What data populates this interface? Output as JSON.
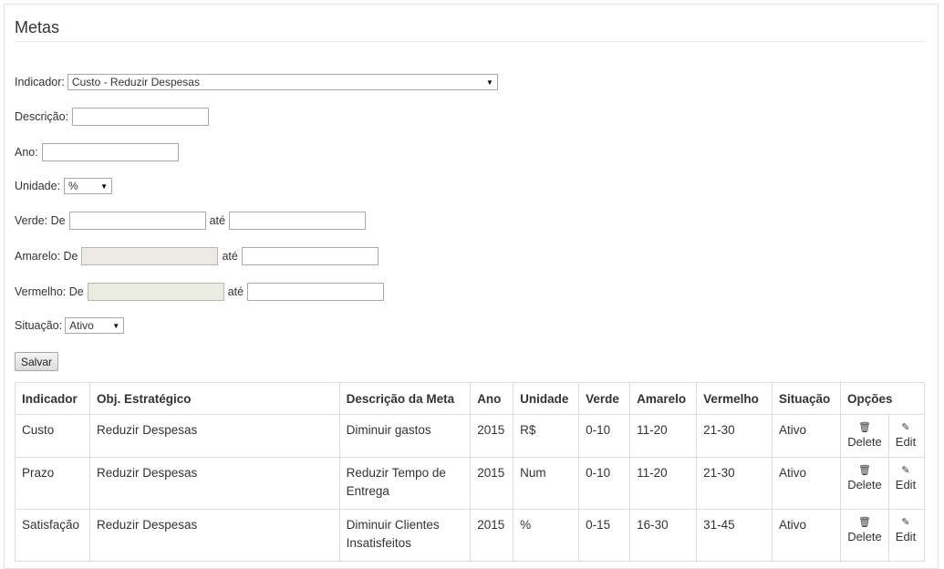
{
  "page": {
    "title": "Metas"
  },
  "form": {
    "indicador": {
      "label": "Indicador:",
      "value": "Custo - Reduzir Despesas"
    },
    "descricao": {
      "label": "Descrição:",
      "value": ""
    },
    "ano": {
      "label": "Ano:",
      "value": ""
    },
    "unidade": {
      "label": "Unidade:",
      "value": "%"
    },
    "verde": {
      "label": "Verde: De",
      "ate": "até",
      "from": "",
      "to": ""
    },
    "amarelo": {
      "label": "Amarelo: De",
      "ate": "até",
      "from": "",
      "to": ""
    },
    "vermelho": {
      "label": "Vermelho: De",
      "ate": "até",
      "from": "",
      "to": ""
    },
    "situacao": {
      "label": "Situação:",
      "value": "Ativo"
    },
    "save_label": "Salvar"
  },
  "table": {
    "headers": [
      "Indicador",
      "Obj. Estratégico",
      "Descrição da Meta",
      "Ano",
      "Unidade",
      "Verde",
      "Amarelo",
      "Vermelho",
      "Situação",
      "Opções"
    ],
    "delete_label": "Delete",
    "edit_label": "Edit",
    "rows": [
      {
        "indicador": "Custo",
        "objetivo": "Reduzir Despesas",
        "descricao": "Diminuir gastos",
        "ano": "2015",
        "unidade": "R$",
        "verde": "0-10",
        "amarelo": "11-20",
        "vermelho": "21-30",
        "situacao": "Ativo"
      },
      {
        "indicador": "Prazo",
        "objetivo": "Reduzir Despesas",
        "descricao": "Reduzir Tempo de Entrega",
        "ano": "2015",
        "unidade": "Num",
        "verde": "0-10",
        "amarelo": "11-20",
        "vermelho": "21-30",
        "situacao": "Ativo"
      },
      {
        "indicador": "Satisfação",
        "objetivo": "Reduzir Despesas",
        "descricao": "Diminuir Clientes Insatisfeitos",
        "ano": "2015",
        "unidade": "%",
        "verde": "0-15",
        "amarelo": "16-30",
        "vermelho": "31-45",
        "situacao": "Ativo"
      }
    ]
  },
  "icons": {
    "delete": "trash-icon",
    "edit": "pencil-icon"
  }
}
